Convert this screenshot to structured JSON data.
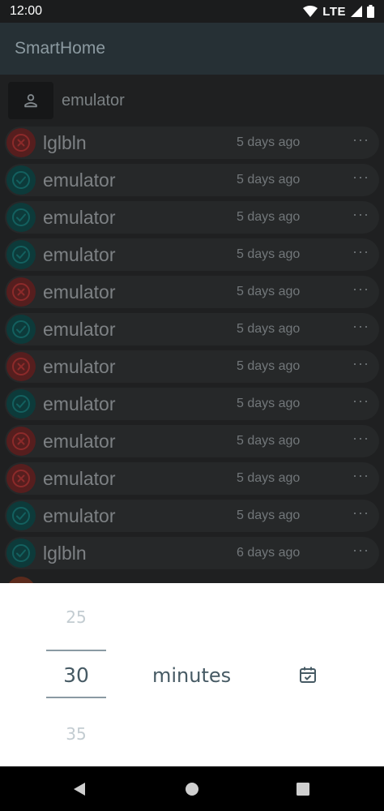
{
  "status_bar": {
    "time": "12:00",
    "network": "LTE"
  },
  "app_bar": {
    "title": "SmartHome"
  },
  "search": {
    "value": "emulator"
  },
  "rows": [
    {
      "name": "lglbln",
      "time": "5 days ago",
      "status": "fail"
    },
    {
      "name": "emulator",
      "time": "5 days ago",
      "status": "ok"
    },
    {
      "name": "emulator",
      "time": "5 days ago",
      "status": "ok"
    },
    {
      "name": "emulator",
      "time": "5 days ago",
      "status": "ok"
    },
    {
      "name": "emulator",
      "time": "5 days ago",
      "status": "fail"
    },
    {
      "name": "emulator",
      "time": "5 days ago",
      "status": "ok"
    },
    {
      "name": "emulator",
      "time": "5 days ago",
      "status": "fail"
    },
    {
      "name": "emulator",
      "time": "5 days ago",
      "status": "ok"
    },
    {
      "name": "emulator",
      "time": "5 days ago",
      "status": "fail"
    },
    {
      "name": "emulator",
      "time": "5 days ago",
      "status": "fail"
    },
    {
      "name": "emulator",
      "time": "5 days ago",
      "status": "ok"
    },
    {
      "name": "lglbln",
      "time": "6 days ago",
      "status": "ok"
    }
  ],
  "row_menu_label": "···",
  "picker": {
    "previous": "25",
    "current": "30",
    "next": "35",
    "unit": "minutes"
  },
  "icons": {
    "user": "user-icon",
    "ok": "check-circle-icon",
    "fail": "x-circle-icon",
    "more": "more-horiz-icon",
    "calendar": "calendar-check-icon",
    "back": "back-triangle-icon",
    "home": "home-circle-icon",
    "recents": "recents-square-icon"
  },
  "colors": {
    "ok_ring": "#13605f",
    "fail_ring": "#8c2a2a",
    "app_bar": "#263035",
    "picker_text": "#465a64"
  }
}
